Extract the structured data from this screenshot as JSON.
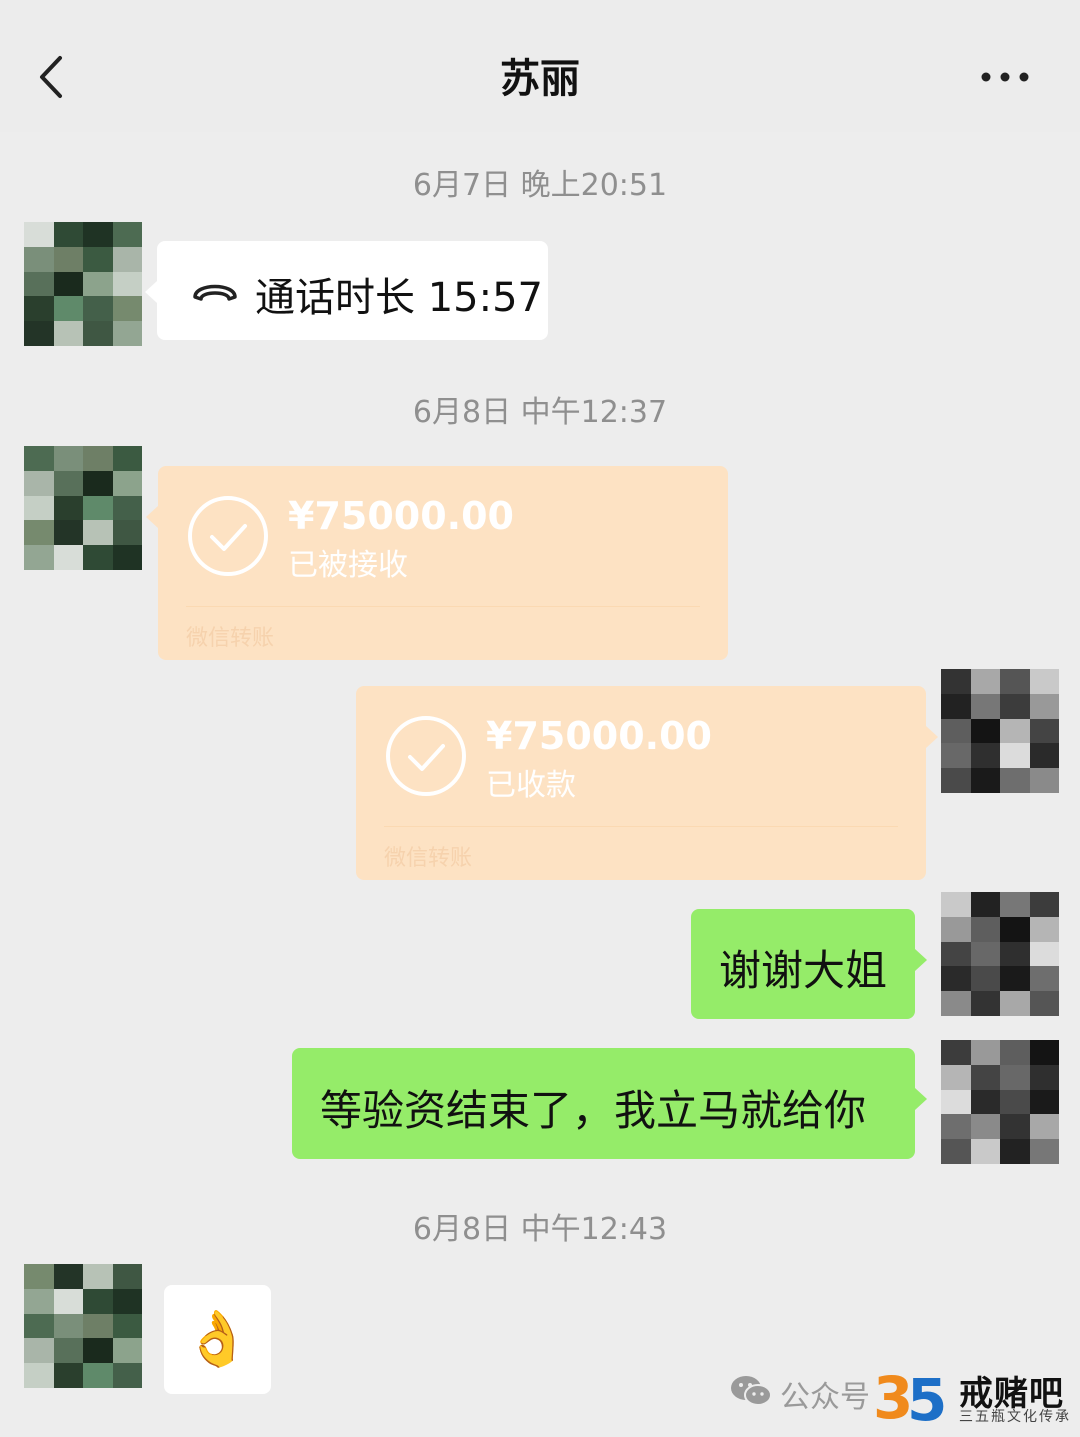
{
  "header": {
    "title": "苏丽",
    "back_icon": "chevron-left-icon",
    "more_icon": "ellipsis-icon"
  },
  "messages": {
    "ts1": "6月7日 晚上20:51",
    "call": {
      "icon": "phone-hangup-icon",
      "text": "通话时长 15:57"
    },
    "ts2": "6月8日 中午12:37",
    "transfer_in": {
      "amount": "¥75000.00",
      "status": "已被接收",
      "footer": "微信转账"
    },
    "transfer_out": {
      "amount": "¥75000.00",
      "status": "已收款",
      "footer": "微信转账"
    },
    "msg_thanks": "谢谢大姐",
    "msg_promise": "等验资结束了，我立马就给你",
    "ts3": "6月8日 中午12:43",
    "emoji": "👌"
  },
  "watermark": {
    "label": "公众号",
    "brand": "戒赌吧",
    "sub": "三五瓶文化传承"
  },
  "colors": {
    "background": "#ededed",
    "green_bubble": "#95ec69",
    "transfer_bubble": "#fde2c3",
    "timestamp": "#8f8f8f"
  }
}
